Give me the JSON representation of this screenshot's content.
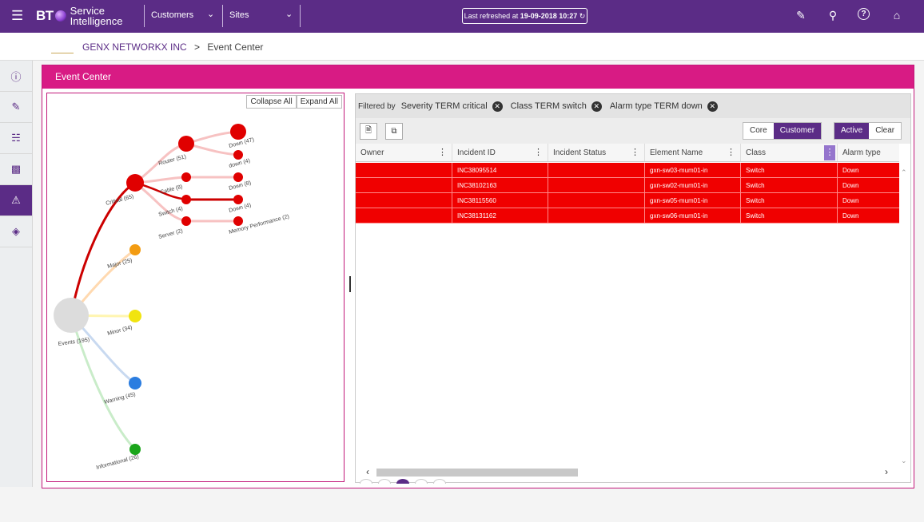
{
  "topbar": {
    "menu_icon": "hamburger-icon",
    "logo": "BT",
    "brand_line1": "Service",
    "brand_line2": "Intelligence",
    "customers_label": "Customers",
    "sites_label": "Sites",
    "refresh_prefix": "Last refreshed at ",
    "refresh_time": "19-09-2018 10:27",
    "icons": [
      "edit-icon",
      "search-icon",
      "help-icon",
      "home-icon"
    ]
  },
  "breadcrumb": {
    "org": "GENX NETWORKX INC",
    "separator": ">",
    "page": "Event Center"
  },
  "sidebar": {
    "items": [
      "info-icon",
      "checklist-icon",
      "network-icon",
      "dashboard-icon",
      "alert-icon",
      "diamond-icon"
    ],
    "active_index": 4
  },
  "panel": {
    "title": "Event Center"
  },
  "tree": {
    "collapse_label": "Collapse All",
    "expand_label": "Expand All",
    "root": "Events (195)",
    "severities": [
      "Critical (65)",
      "Major (25)",
      "Minor (34)",
      "Warning (45)",
      "Informational (26)"
    ],
    "classes": [
      "Router (51)",
      "Cable (8)",
      "Switch (4)",
      "Server (2)"
    ],
    "alarms": [
      "Down (47)",
      "down (4)",
      "Down (8)",
      "Down (4)",
      "Memory Performance (2)"
    ],
    "colors": {
      "critical": "#e00000",
      "major": "#f39c12",
      "minor": "#f1e40f",
      "warning": "#2b7de0",
      "informational": "#1aa51a",
      "root": "#dcdcdc"
    }
  },
  "filters": {
    "label": "Filtered by",
    "chips": [
      "Severity TERM critical",
      "Class TERM switch",
      "Alarm type TERM down"
    ]
  },
  "toolbar": {
    "icons": [
      "export-icon",
      "copy-icon"
    ],
    "scope": {
      "core": "Core",
      "customer": "Customer",
      "selected": "Customer"
    },
    "state": {
      "active": "Active",
      "clear": "Clear",
      "selected": "Active"
    }
  },
  "grid": {
    "columns": [
      "Owner",
      "Incident ID",
      "Incident Status",
      "Element Name",
      "Class",
      "Alarm type"
    ],
    "rows": [
      {
        "owner": "",
        "incident_id": "INC38095514",
        "status": "",
        "element": "gxn-sw03-mum01-in",
        "class": "Switch",
        "alarm": "Down"
      },
      {
        "owner": "",
        "incident_id": "INC38102163",
        "status": "",
        "element": "gxn-sw02-mum01-in",
        "class": "Switch",
        "alarm": "Down"
      },
      {
        "owner": "",
        "incident_id": "INC38115560",
        "status": "",
        "element": "gxn-sw05-mum01-in",
        "class": "Switch",
        "alarm": "Down"
      },
      {
        "owner": "",
        "incident_id": "INC38131162",
        "status": "",
        "element": "gxn-sw06-mum01-in",
        "class": "Switch",
        "alarm": "Down"
      }
    ],
    "row_color": "#f00000"
  }
}
